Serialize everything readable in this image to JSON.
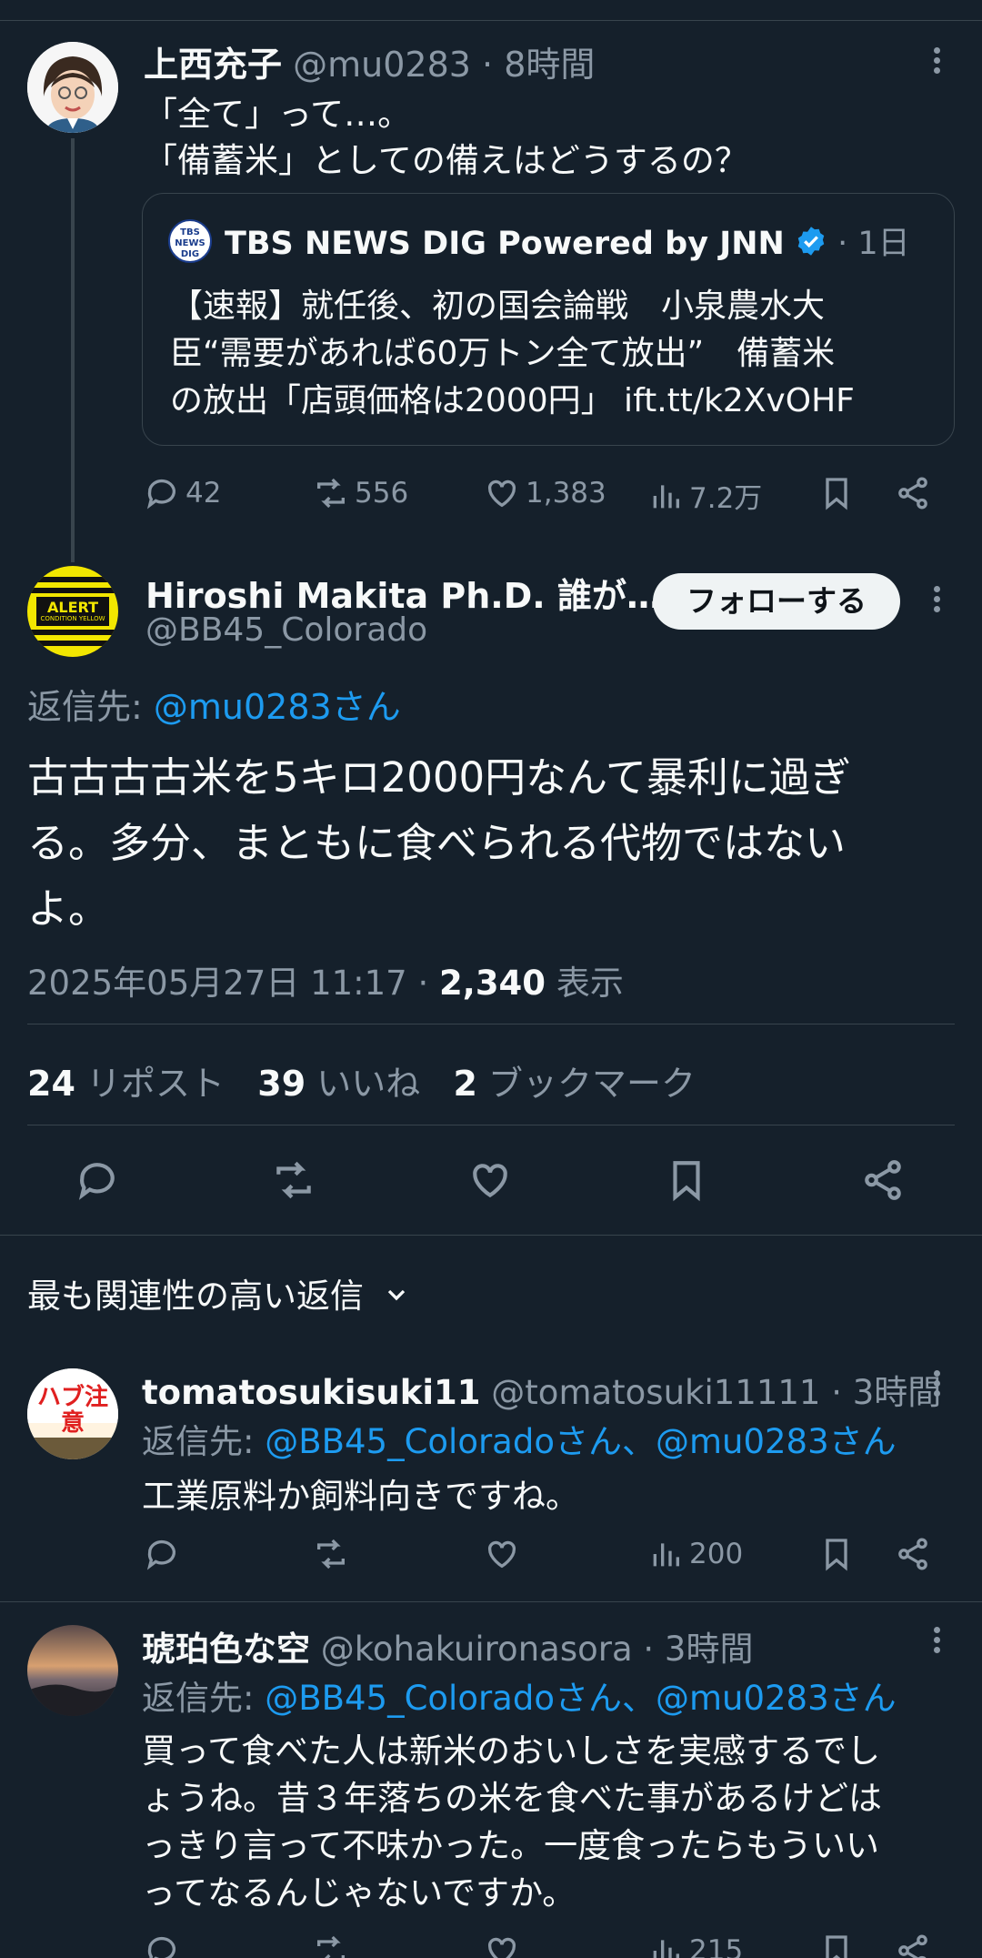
{
  "colors": {
    "background": "#15202b",
    "text": "#f7f9f9",
    "muted": "#8b98a5",
    "link": "#1d9bf0",
    "verified": "#1d9bf0"
  },
  "parent_tweet": {
    "author_name": "上西充子",
    "author_handle": "@mu0283",
    "time": "8時間",
    "text_lines": [
      "「全て」って…。",
      "「備蓄米」としての備えはどうするの？"
    ],
    "quote": {
      "author_name": "TBS NEWS DIG Powered by JNN",
      "time": "1日",
      "logo_lines": [
        "TBS",
        "NEWS",
        "DIG"
      ],
      "text_lines": [
        "【速報】就任後、初の国会論戦　小泉農水大",
        "臣“需要があれば60万トン全て放出”　備蓄米",
        "の放出「店頭価格は2000円」 ift.tt/k2XvOHF"
      ]
    },
    "stats": {
      "replies": "42",
      "reposts": "556",
      "likes": "1,383",
      "views": "7.2万"
    }
  },
  "main_tweet": {
    "author_name": "Hiroshi Makita Ph.D. 誰が…",
    "author_handle": "@BB45_Colorado",
    "follow_label": "フォローする",
    "avatar_text": {
      "top": "ALERT",
      "bottom": "CONDITION YELLOW"
    },
    "reply_to_label": "返信先:",
    "reply_to_handle": "@mu0283さん",
    "text_lines": [
      "古古古古米を5キロ2000円なんて暴利に過ぎ",
      "る。多分、まともに食べられる代物ではない",
      "よ。"
    ],
    "timestamp": "2025年05月27日 11:17",
    "separator": "·",
    "views_count": "2,340",
    "views_label": "表示",
    "engagement": {
      "reposts_count": "24",
      "reposts_label": "リポスト",
      "likes_count": "39",
      "likes_label": "いいね",
      "bookmarks_count": "2",
      "bookmarks_label": "ブックマーク"
    }
  },
  "replies_sort": {
    "label": "最も関連性の高い返信"
  },
  "replies": [
    {
      "author_name": "tomatosukisuki11",
      "author_handle": "@tomatosuki11111",
      "time": "3時間",
      "reply_to_label": "返信先:",
      "reply_to_handles": "@BB45_Coloradoさん、@mu0283さん",
      "text_lines": [
        "工業原料か飼料向きですね。"
      ],
      "views": "200",
      "avatar_text": "ハブ注意"
    },
    {
      "author_name": "琥珀色な空",
      "author_handle": "@kohakuironasora",
      "time": "3時間",
      "reply_to_label": "返信先:",
      "reply_to_handles": "@BB45_Coloradoさん、@mu0283さん",
      "text_lines": [
        "買って食べた人は新米のおいしさを実感するでし",
        "ょうね。昔３年落ちの米を食べた事があるけどは",
        "っきり言って不味かった。一度食ったらもういい",
        "ってなるんじゃないですか。"
      ],
      "views": "215"
    }
  ]
}
